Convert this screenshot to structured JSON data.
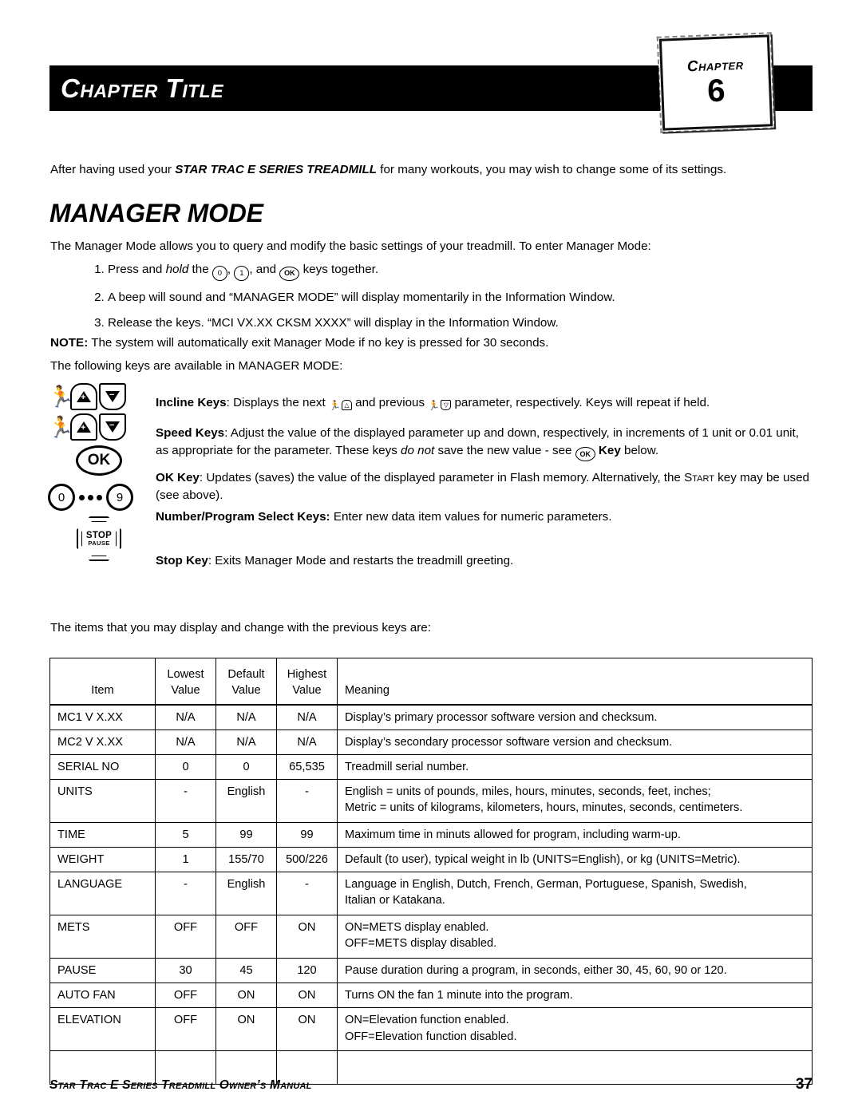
{
  "header": {
    "chapter_title": "Chapter Title",
    "badge_word": "Chapter",
    "badge_number": "6"
  },
  "intro": {
    "before": "After having used your ",
    "product": "STAR TRAC E SERIES TREADMILL",
    "after": " for many workouts, you may wish to change some of its settings."
  },
  "section": {
    "title": "MANAGER MODE",
    "lead": "The Manager Mode allows you to query and modify the basic settings of your treadmill. To enter Manager Mode:"
  },
  "steps": [
    {
      "prefix": "Press and ",
      "emphasis": "hold",
      "middle": " the ",
      "key_0": "0",
      "key_1": "1",
      "key_ok": "OK",
      "suffix": " keys together."
    },
    {
      "text": "A beep will sound and “MANAGER MODE” will display momentarily in the Information Window."
    },
    {
      "text": "Release the keys. “MCI VX.XX   CKSM   XXXX” will display in the Information Window."
    }
  ],
  "note": {
    "label": "NOTE:",
    "text": " The system will automatically exit Manager Mode if no key is pressed for 30 seconds."
  },
  "following_keys_line": "The following keys are available in MANAGER MODE:",
  "key_legend": {
    "incline_icon_label": "incline-keys-icon",
    "speed_icon_label": "speed-keys-icon",
    "up_sign": "+",
    "down_sign": "−",
    "ok_label": "OK",
    "num_first": "0",
    "num_last": "9",
    "stop_label": "STOP",
    "pause_label": "PAUSE"
  },
  "key_descriptions": {
    "incline": {
      "title": "Incline Keys",
      "part1": ": Displays the next ",
      "part2": " and previous ",
      "part3": " parameter, respectively. Keys will repeat if held."
    },
    "speed": {
      "title": "Speed Keys",
      "part1": ": Adjust the value of the displayed parameter up and down, respectively, in increments of 1 unit or 0.01 unit, as appropriate for the parameter. These keys ",
      "emphasis": "do not",
      "part2": " save the new value - see ",
      "key_ok": "OK",
      "bold_key": " Key",
      "part3": " below."
    },
    "ok": {
      "title": "OK Key",
      "part1": ": Updates (saves) the value of the displayed parameter in Flash memory. Alternatively, the ",
      "start_key": "Start",
      "part2": " key may be used (see above)."
    },
    "number": {
      "title": "Number/Program Select Keys:",
      "text": " Enter new data item values for numeric parameters."
    },
    "stop": {
      "title": "Stop Key",
      "text": ": Exits Manager Mode and restarts the treadmill greeting."
    }
  },
  "items_lead": "The items that you may display and change with the previous keys are:",
  "table": {
    "headers": {
      "item": "Item",
      "lowest_line1": "Lowest",
      "lowest_line2": "Value",
      "default_line1": "Default",
      "default_line2": "Value",
      "highest_line1": "Highest",
      "highest_line2": "Value",
      "meaning": "Meaning"
    },
    "rows": [
      {
        "item": "MC1 V X.XX",
        "lowest": "N/A",
        "default": "N/A",
        "highest": "N/A",
        "meaning": [
          "Display’s primary processor software version and checksum."
        ]
      },
      {
        "item": "MC2 V X.XX",
        "lowest": "N/A",
        "default": "N/A",
        "highest": "N/A",
        "meaning": [
          "Display’s secondary processor software version and checksum."
        ]
      },
      {
        "item": "SERIAL NO",
        "lowest": "0",
        "default": "0",
        "highest": "65,535",
        "meaning": [
          "Treadmill serial number."
        ]
      },
      {
        "item": "UNITS",
        "lowest": "-",
        "default": "English",
        "highest": "-",
        "meaning": [
          "English = units of pounds, miles, hours, minutes, seconds, feet, inches;",
          "Metric = units of kilograms, kilometers, hours, minutes, seconds, centimeters."
        ]
      },
      {
        "item": "TIME",
        "lowest": "5",
        "default": "99",
        "highest": "99",
        "meaning": [
          "Maximum time in minuts allowed for program, including warm-up."
        ]
      },
      {
        "item": "WEIGHT",
        "lowest": "1",
        "default": "155/70",
        "highest": "500/226",
        "meaning": [
          "Default (to user), typical weight in lb (UNITS=English), or kg (UNITS=Metric)."
        ]
      },
      {
        "item": "LANGUAGE",
        "lowest": "-",
        "default": "English",
        "highest": "-",
        "meaning": [
          "Language in English, Dutch, French, German, Portuguese, Spanish, Swedish,",
          "Italian or Katakana."
        ]
      },
      {
        "item": "METS",
        "lowest": "OFF",
        "default": "OFF",
        "highest": "ON",
        "meaning": [
          "ON=METS display enabled.",
          "OFF=METS display disabled."
        ]
      },
      {
        "item": "PAUSE",
        "lowest": "30",
        "default": "45",
        "highest": "120",
        "meaning": [
          "Pause duration during a program, in seconds, either 30, 45, 60, 90 or 120."
        ]
      },
      {
        "item": "AUTO FAN",
        "lowest": "OFF",
        "default": "ON",
        "highest": "ON",
        "meaning": [
          "Turns ON the fan 1 minute into the program."
        ]
      },
      {
        "item": "ELEVATION",
        "lowest": "OFF",
        "default": "ON",
        "highest": "ON",
        "meaning": [
          "ON=Elevation function enabled.",
          "OFF=Elevation function disabled."
        ]
      }
    ]
  },
  "footer": {
    "text": "Star Trac E Series Treadmill Owner’s Manual",
    "page": "37"
  }
}
